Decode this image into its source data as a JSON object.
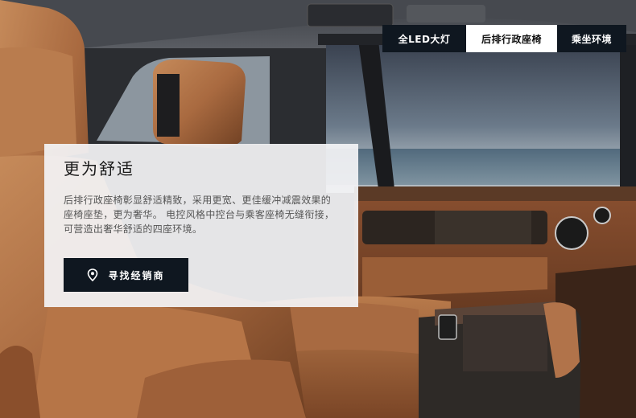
{
  "tabs": [
    {
      "label": "全LED大灯",
      "active": false
    },
    {
      "label": "后排行政座椅",
      "active": true
    },
    {
      "label": "乘坐环境",
      "active": false
    }
  ],
  "card": {
    "title": "更为舒适",
    "body": "后排行政座椅彰显舒适精致，采用更宽、更佳缓冲减震效果的座椅座垫，更为奢华。 电控风格中控台与乘客座椅无缝衔接，可营造出奢华舒适的四座环境。",
    "button_label": "寻找经销商",
    "button_icon": "location-pin-icon"
  },
  "colors": {
    "accent_dark": "#0f1720",
    "leather": "#a96a40",
    "card_bg": "#f3f3f5"
  }
}
